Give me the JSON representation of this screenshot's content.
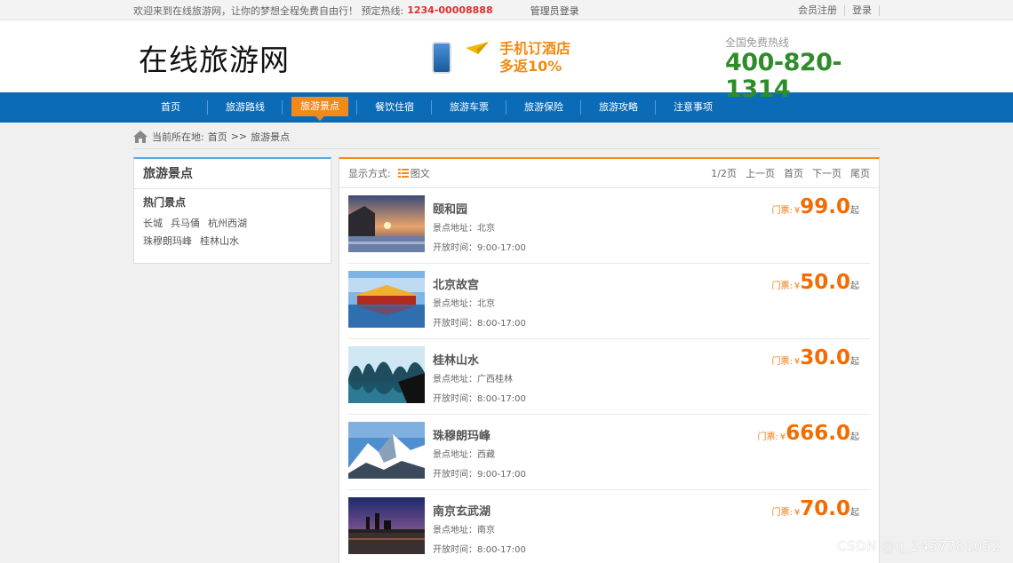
{
  "topbar": {
    "welcome": "欢迎来到在线旅游网，让你的梦想全程免费自由行！ 预定热线:",
    "hotline": "1234-00008888",
    "admin": "管理员登录",
    "register": "会员注册",
    "login": "登录"
  },
  "header": {
    "logo": "在线旅游网",
    "promo_line1": "手机订酒店",
    "promo_line2": "多返10%",
    "hotline_label": "全国免费热线",
    "hotline_number": "400-820-1314"
  },
  "nav": {
    "items": [
      "首页",
      "旅游路线",
      "旅游景点",
      "餐饮住宿",
      "旅游车票",
      "旅游保险",
      "旅游攻略",
      "注意事项"
    ],
    "active_index": 2
  },
  "breadcrumb": {
    "label": "当前所在地:",
    "home": "首页",
    "sep": ">>",
    "current": "旅游景点"
  },
  "sidebar": {
    "title": "旅游景点",
    "subtitle": "热门景点",
    "tags": [
      "长城",
      "兵马俑",
      "杭州西湖",
      "珠穆朗玛峰",
      "桂林山水"
    ]
  },
  "toolbar": {
    "display_label": "显示方式:",
    "mode": "图文",
    "page_info": "1/2页",
    "prev": "上一页",
    "first": "首页",
    "next": "下一页",
    "last": "尾页"
  },
  "list": {
    "price_label": "门票:",
    "currency": "¥",
    "suffix": "起",
    "items": [
      {
        "name": "颐和园",
        "address": "景点地址：北京",
        "hours": "开放时间：9:00-17:00",
        "price": "99.0",
        "thumb": "sunset-palace"
      },
      {
        "name": "北京故宫",
        "address": "景点地址：北京",
        "hours": "开放时间：8:00-17:00",
        "price": "50.0",
        "thumb": "forbidden-city"
      },
      {
        "name": "桂林山水",
        "address": "景点地址：广西桂林",
        "hours": "开放时间：8:00-17:00",
        "price": "30.0",
        "thumb": "karst-river"
      },
      {
        "name": "珠穆朗玛峰",
        "address": "景点地址：西藏",
        "hours": "开放时间：9:00-17:00",
        "price": "666.0",
        "thumb": "snow-mountain"
      },
      {
        "name": "南京玄武湖",
        "address": "景点地址：南京",
        "hours": "开放时间：8:00-17:00",
        "price": "70.0",
        "thumb": "lake-dusk"
      }
    ]
  },
  "colors": {
    "nav_blue": "#0c6bb7",
    "accent_orange": "#f28a17",
    "price_orange": "#f46c00",
    "hotline_green": "#2e8d2a",
    "hot_red": "#e32d2d"
  },
  "watermark": "CSDN @q_2457781052"
}
